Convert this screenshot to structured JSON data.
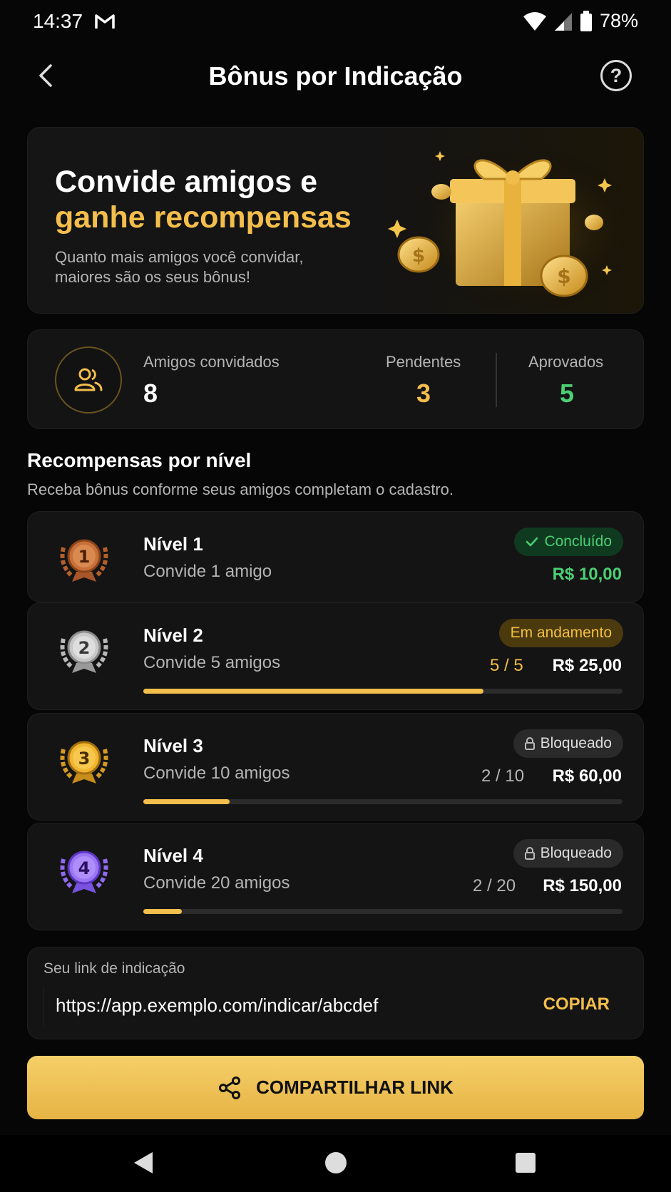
{
  "status_bar": {
    "time": "14:37",
    "battery": "78%",
    "icons": [
      "gmail-icon",
      "wifi-icon",
      "signal-icon",
      "battery-icon"
    ]
  },
  "header": {
    "title": "Bônus por Indicação",
    "back_icon": "chevron-left-icon",
    "help_icon": "?"
  },
  "hero": {
    "title_line1": "Convide amigos e",
    "title_line2": "ganhe recompensas",
    "subtitle": "Quanto mais amigos você convidar, maiores são os seus bônus!",
    "image": "gift-box-with-coins"
  },
  "stats": {
    "invited_label": "Amigos convidados",
    "invited_value": "8",
    "pending_label": "Pendentes",
    "pending_value": "3",
    "approved_label": "Aprovados",
    "approved_value": "5"
  },
  "rewards": {
    "title": "Recompensas por nível",
    "subtitle": "Receba bônus conforme seus amigos completam o cadastro.",
    "levels": [
      {
        "medal": "1",
        "name": "Nível 1",
        "desc": "Convide 1 amigo",
        "status": "Concluído",
        "count": "",
        "reward": "R$ 10,00",
        "progress": null
      },
      {
        "medal": "2",
        "name": "Nível 2",
        "desc": "Convide 5 amigos",
        "status": "Em andamento",
        "count": "5 / 5",
        "reward": "R$ 25,00",
        "progress": 0.71
      },
      {
        "medal": "3",
        "name": "Nível 3",
        "desc": "Convide 10 amigos",
        "status": "Bloqueado",
        "count": "2 / 10",
        "reward": "R$ 60,00",
        "progress": 0.18
      },
      {
        "medal": "4",
        "name": "Nível 4",
        "desc": "Convide 20 amigos",
        "status": "Bloqueado",
        "count": "2 / 20",
        "reward": "R$ 150,00",
        "progress": 0.08
      }
    ]
  },
  "referral": {
    "label": "Seu link de indicação",
    "url": "https://app.exemplo.com/indicar/abcdef",
    "copy_label": "COPIAR"
  },
  "share": {
    "label": "COMPARTILHAR LINK"
  },
  "colors": {
    "accent": "#f3be4b",
    "success": "#4ccf74",
    "background": "#060606",
    "card": "#141414"
  }
}
